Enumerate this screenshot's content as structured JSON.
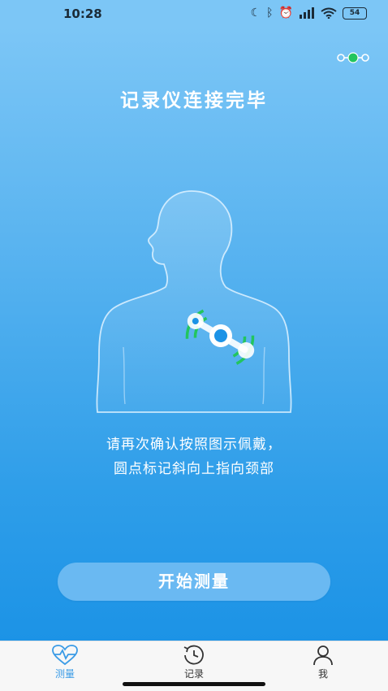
{
  "status_bar": {
    "time": "10:28",
    "battery": "54",
    "icons": [
      "moon-icon",
      "bluetooth-icon",
      "alarm-icon",
      "signal-icon",
      "wifi-icon",
      "battery-icon"
    ]
  },
  "header": {
    "title": "记录仪连接完毕",
    "device_status_icon": "device-connected-icon"
  },
  "illustration": {
    "description_icon": "body-with-recorder-icon"
  },
  "instruction": {
    "line1": "请再次确认按照图示佩戴，",
    "line2": "圆点标记斜向上指向颈部"
  },
  "start_button": {
    "label": "开始测量"
  },
  "tabbar": {
    "tabs": [
      {
        "label": "测量",
        "icon": "heart-pulse-icon",
        "active": true
      },
      {
        "label": "记录",
        "icon": "history-clock-icon",
        "active": false
      },
      {
        "label": "我",
        "icon": "person-icon",
        "active": false
      }
    ]
  },
  "colors": {
    "gradient_top": "#7cc6f6",
    "gradient_bottom": "#1c93e6",
    "button_bg": "#6ab9f2",
    "active_tab": "#3a9be6",
    "signal_green": "#22c55e"
  }
}
